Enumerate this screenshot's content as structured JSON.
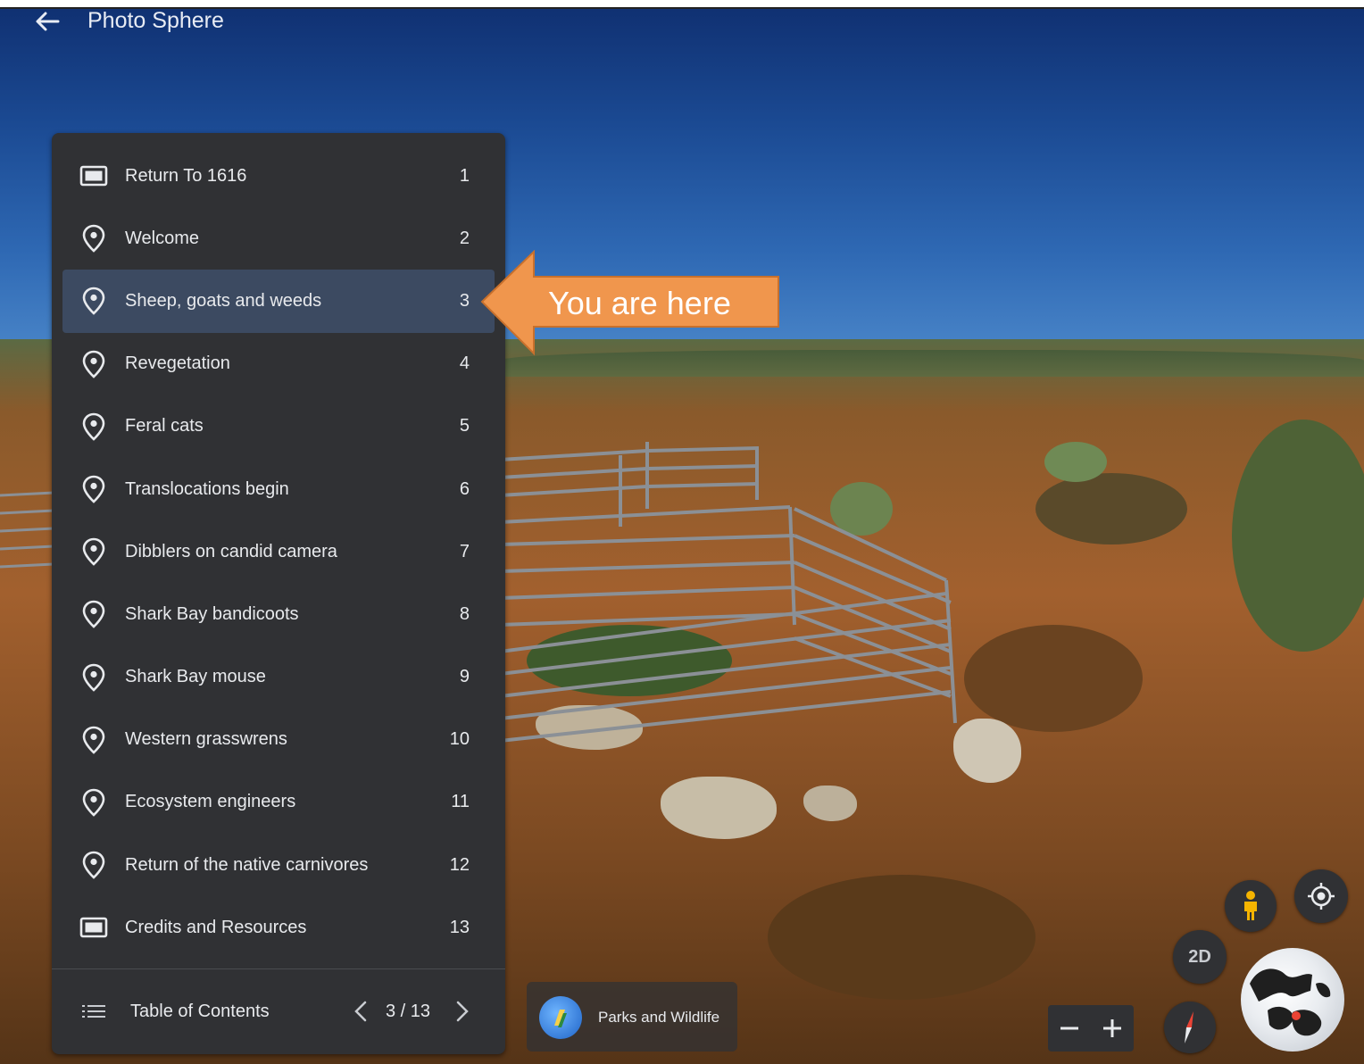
{
  "header": {
    "title": "Photo Sphere",
    "back_icon": "arrow-left-icon"
  },
  "toc": {
    "active_index": 3,
    "items": [
      {
        "label": "Return To 1616",
        "number": "1",
        "icon": "slide-icon"
      },
      {
        "label": "Welcome",
        "number": "2",
        "icon": "place-pin-icon"
      },
      {
        "label": "Sheep, goats and weeds",
        "number": "3",
        "icon": "place-pin-icon"
      },
      {
        "label": "Revegetation",
        "number": "4",
        "icon": "place-pin-icon"
      },
      {
        "label": "Feral cats",
        "number": "5",
        "icon": "place-pin-icon"
      },
      {
        "label": "Translocations begin",
        "number": "6",
        "icon": "place-pin-icon"
      },
      {
        "label": "Dibblers on candid camera",
        "number": "7",
        "icon": "place-pin-icon"
      },
      {
        "label": "Shark Bay bandicoots",
        "number": "8",
        "icon": "place-pin-icon"
      },
      {
        "label": "Shark Bay mouse",
        "number": "9",
        "icon": "place-pin-icon"
      },
      {
        "label": "Western grasswrens",
        "number": "10",
        "icon": "place-pin-icon"
      },
      {
        "label": "Ecosystem engineers",
        "number": "11",
        "icon": "place-pin-icon"
      },
      {
        "label": "Return of the native carnivores",
        "number": "12",
        "icon": "place-pin-icon"
      },
      {
        "label": "Credits and Resources",
        "number": "13",
        "icon": "slide-icon"
      }
    ],
    "footer": {
      "title": "Table of Contents",
      "pager": "3 / 13"
    }
  },
  "callout": {
    "text": "You are here",
    "color": "#f0964d"
  },
  "attribution": {
    "text": "Parks and Wildlife"
  },
  "controls": {
    "view_mode_label": "2D"
  },
  "colors": {
    "panel_bg": "#303134",
    "active_row": "#3c4a61",
    "text": "#e8eaed"
  }
}
